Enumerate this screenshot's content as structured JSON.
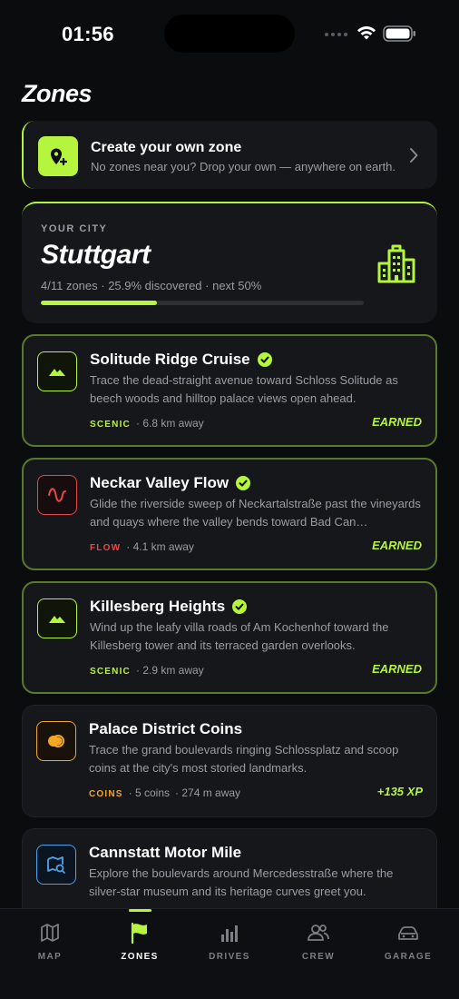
{
  "status_bar": {
    "time": "01:56"
  },
  "page": {
    "title": "Zones"
  },
  "create_zone": {
    "title": "Create your own zone",
    "subtitle": "No zones near you? Drop your own — anywhere on earth."
  },
  "city": {
    "label": "YOUR CITY",
    "name": "Stuttgart",
    "stats": "4/11 zones · 25.9% discovered · next 50%",
    "progress_fraction": 0.359
  },
  "zones": [
    {
      "title": "Solitude Ridge Cruise",
      "completed": true,
      "icon": "mountain-icon",
      "description": "Trace the dead-straight avenue toward Schloss Solitude as beech woods and hilltop palace views open ahead.",
      "tag": "SCENIC",
      "distance": "· 6.8 km away",
      "badge": "EARNED"
    },
    {
      "title": "Neckar Valley Flow",
      "completed": true,
      "icon": "wave-icon",
      "description": "Glide the riverside sweep of Neckartalstraße past the vineyards and quays where the valley bends toward Bad Can…",
      "tag": "FLOW",
      "distance": "· 4.1 km away",
      "badge": "EARNED"
    },
    {
      "title": "Killesberg Heights",
      "completed": true,
      "icon": "mountain-icon",
      "description": "Wind up the leafy villa roads of Am Kochenhof toward the Killesberg tower and its terraced garden overlooks.",
      "tag": "SCENIC",
      "distance": "· 2.9 km away",
      "badge": "EARNED"
    },
    {
      "title": "Palace District Coins",
      "completed": false,
      "icon": "coins-icon",
      "description": "Trace the grand boulevards ringing Schlossplatz and scoop coins at the city's most storied landmarks.",
      "tag": "COINS",
      "coins": "· 5 coins",
      "distance": "· 274 m away",
      "badge": "+135 XP"
    },
    {
      "title": "Cannstatt Motor Mile",
      "completed": false,
      "icon": "map-search-icon",
      "description": "Explore the boulevards around Mercedesstraße where the silver-star museum and its heritage curves greet you."
    }
  ],
  "tabs": [
    {
      "label": "MAP",
      "icon": "map-icon"
    },
    {
      "label": "ZONES",
      "icon": "flag-icon",
      "active": true
    },
    {
      "label": "DRIVES",
      "icon": "bar-chart-icon"
    },
    {
      "label": "CREW",
      "icon": "people-icon"
    },
    {
      "label": "GARAGE",
      "icon": "car-icon"
    }
  ],
  "colors": {
    "accent": "#b6f53e",
    "flow": "#e5484d",
    "coins": "#f5a623",
    "explore": "#4aa3f0",
    "background": "#0b0c0e",
    "card": "#15171b"
  }
}
